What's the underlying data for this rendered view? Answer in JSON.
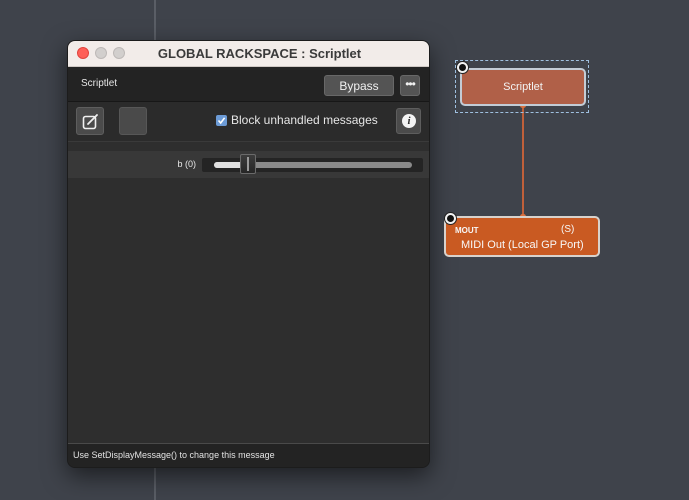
{
  "window": {
    "title": "GLOBAL RACKSPACE : Scriptlet"
  },
  "plugin_header": {
    "name": "Scriptlet",
    "bypass_label": "Bypass",
    "more_label": "•••"
  },
  "toolbar": {
    "block_label": "Block unhandled messages",
    "block_checked": true,
    "info_label": "i"
  },
  "params": [
    {
      "label": "b (0)",
      "value": 0.17
    }
  ],
  "status": {
    "message": "Use SetDisplayMessage() to change this message"
  },
  "nodes": {
    "scriptlet": {
      "label": "Scriptlet"
    },
    "midi_out": {
      "tag": "MOUT",
      "suffix": "(S)",
      "name": "MIDI Out (Local GP Port)"
    }
  },
  "colors": {
    "canvas": "#3f434b",
    "scriptlet_node": "#b06048",
    "midi_node": "#c95a22",
    "connection": "#c0603a",
    "checkbox": "#6c9bd6"
  }
}
